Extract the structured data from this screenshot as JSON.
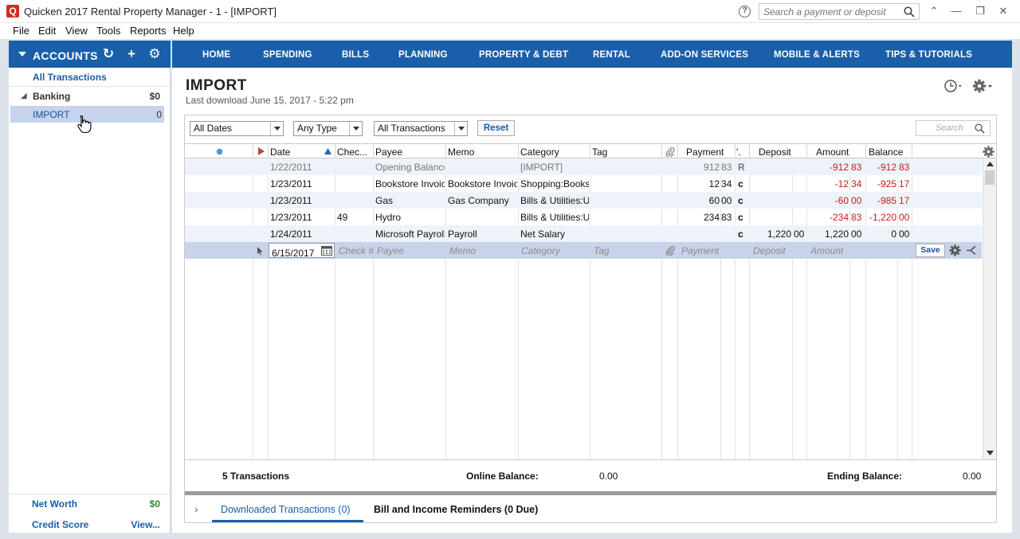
{
  "window": {
    "logo_letter": "Q",
    "title": "Quicken 2017 Rental Property Manager - 1 - [IMPORT]",
    "search_placeholder": "Search a payment or deposit"
  },
  "menu": [
    "File",
    "Edit",
    "View",
    "Tools",
    "Reports",
    "Help"
  ],
  "sidebar": {
    "header": "ACCOUNTS",
    "all_transactions": "All Transactions",
    "banking": {
      "label": "Banking",
      "amount": "$0"
    },
    "import": {
      "label": "IMPORT",
      "amount": "0"
    },
    "net_worth": {
      "label": "Net Worth",
      "amount": "$0"
    },
    "credit_score": {
      "label": "Credit Score",
      "link": "View..."
    }
  },
  "nav": [
    "HOME",
    "SPENDING",
    "BILLS",
    "PLANNING",
    "PROPERTY & DEBT",
    "RENTAL",
    "ADD-ON SERVICES",
    "MOBILE & ALERTS",
    "TIPS & TUTORIALS"
  ],
  "page": {
    "title": "IMPORT",
    "last_download": "Last download June 15, 2017 - 5:22 pm"
  },
  "filters": {
    "dates": "All Dates",
    "type": "Any Type",
    "transactions": "All Transactions",
    "reset": "Reset",
    "search_placeholder": "Search"
  },
  "columns": {
    "date": "Date",
    "check": "Chec...",
    "payee": "Payee",
    "memo": "Memo",
    "category": "Category",
    "tag": "Tag",
    "payment": "Payment",
    "clr": "'.",
    "deposit": "Deposit",
    "amount": "Amount",
    "balance": "Balance"
  },
  "rows": [
    {
      "date": "1/22/2011",
      "check": "",
      "payee": "Opening Balance",
      "memo": "",
      "category": "[IMPORT]",
      "payment": "912",
      "payment_c": "83",
      "clr": "R",
      "deposit": "",
      "deposit_c": "",
      "amount": "-912",
      "amount_c": "83",
      "balance": "-912",
      "balance_c": "83"
    },
    {
      "date": "1/23/2011",
      "check": "",
      "payee": "Bookstore Invoice",
      "memo": "Bookstore Invoice",
      "category": "Shopping:Books",
      "payment": "12",
      "payment_c": "34",
      "clr": "c",
      "deposit": "",
      "deposit_c": "",
      "amount": "-12",
      "amount_c": "34",
      "balance": "-925",
      "balance_c": "17"
    },
    {
      "date": "1/23/2011",
      "check": "",
      "payee": "Gas",
      "memo": "Gas Company",
      "category": "Bills & Utilities:Utilities",
      "payment": "60",
      "payment_c": "00",
      "clr": "c",
      "deposit": "",
      "deposit_c": "",
      "amount": "-60",
      "amount_c": "00",
      "balance": "-985",
      "balance_c": "17"
    },
    {
      "date": "1/23/2011",
      "check": "49",
      "payee": "Hydro",
      "memo": "",
      "category": "Bills & Utilities:Utilities",
      "payment": "234",
      "payment_c": "83",
      "clr": "c",
      "deposit": "",
      "deposit_c": "",
      "amount": "-234",
      "amount_c": "83",
      "balance": "-1,220",
      "balance_c": "00"
    },
    {
      "date": "1/24/2011",
      "check": "",
      "payee": "Microsoft Payroll",
      "memo": "Payroll",
      "category": "Net Salary",
      "payment": "",
      "payment_c": "",
      "clr": "c",
      "deposit": "1,220",
      "deposit_c": "00",
      "amount": "1,220",
      "amount_c": "00",
      "balance": "0",
      "balance_c": "00"
    }
  ],
  "entry": {
    "date": "6/15/2017",
    "check_ph": "Check #",
    "payee_ph": "Payee",
    "memo_ph": "Memo",
    "category_ph": "Category",
    "tag_ph": "Tag",
    "payment_ph": "Payment",
    "deposit_ph": "Deposit",
    "amount_ph": "Amount",
    "save": "Save"
  },
  "summary": {
    "count": "5 Transactions",
    "online_label": "Online Balance:",
    "online_value": "0.00",
    "ending_label": "Ending Balance:",
    "ending_value": "0.00"
  },
  "bottom_tabs": {
    "downloaded": "Downloaded Transactions (0)",
    "reminders": "Bill and Income Reminders (0 Due)"
  }
}
